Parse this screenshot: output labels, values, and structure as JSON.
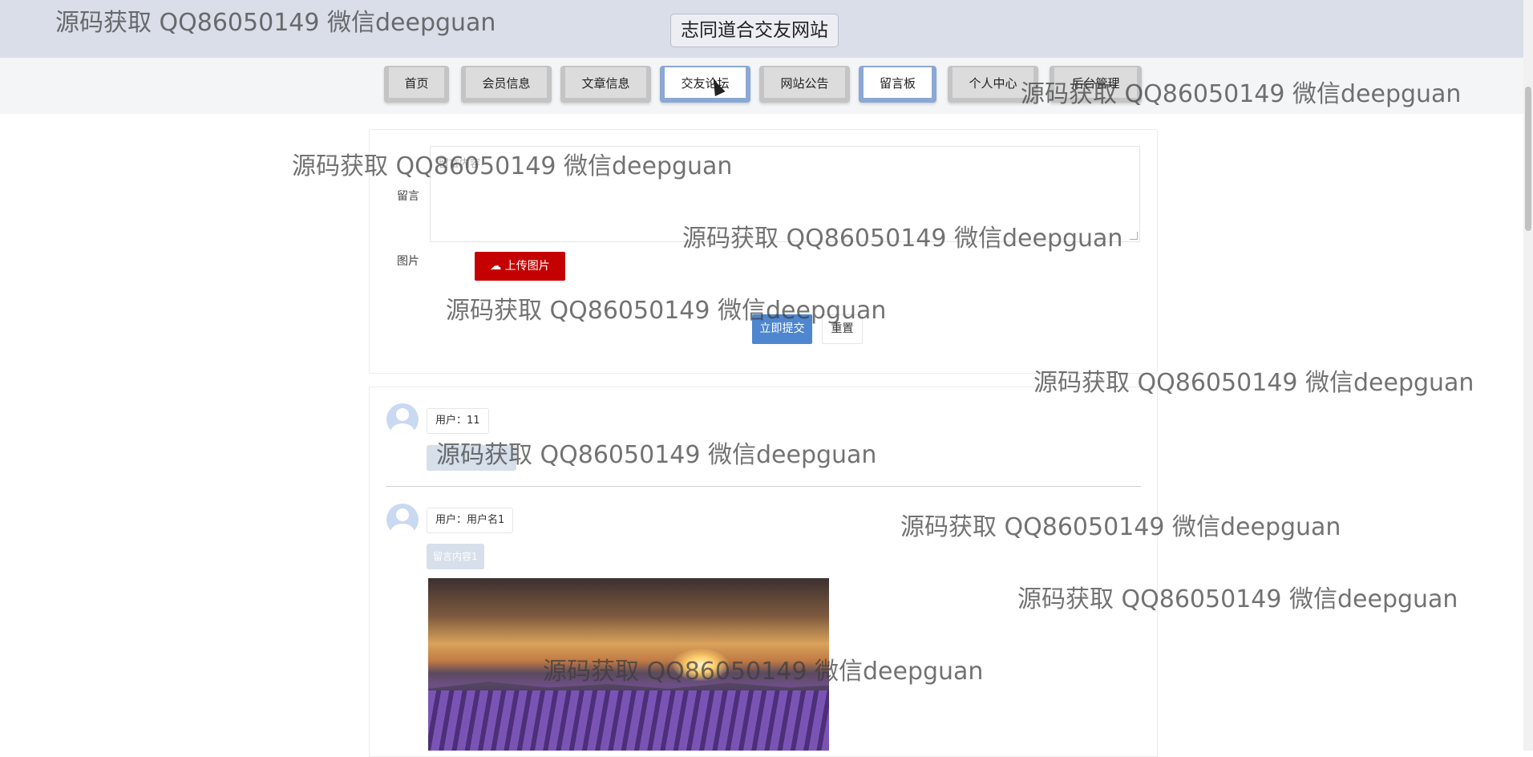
{
  "header": {
    "site_title": "志同道合交友网站"
  },
  "nav": {
    "items": [
      {
        "label": "首页"
      },
      {
        "label": "会员信息"
      },
      {
        "label": "文章信息"
      },
      {
        "label": "交友论坛"
      },
      {
        "label": "网站公告"
      },
      {
        "label": "留言板"
      },
      {
        "label": "个人中心"
      },
      {
        "label": "后台管理"
      }
    ]
  },
  "form": {
    "message_label": "留言",
    "message_placeholder": "留言内容",
    "image_label": "图片",
    "upload_label": "上传图片",
    "submit_label": "立即提交",
    "reset_label": "重置"
  },
  "messages": [
    {
      "user": "用户：11",
      "content": ""
    },
    {
      "user": "用户：用户名1",
      "content": "留言内容1"
    }
  ],
  "watermark": {
    "text": "源码获取 QQ86050149 微信deepguan"
  }
}
